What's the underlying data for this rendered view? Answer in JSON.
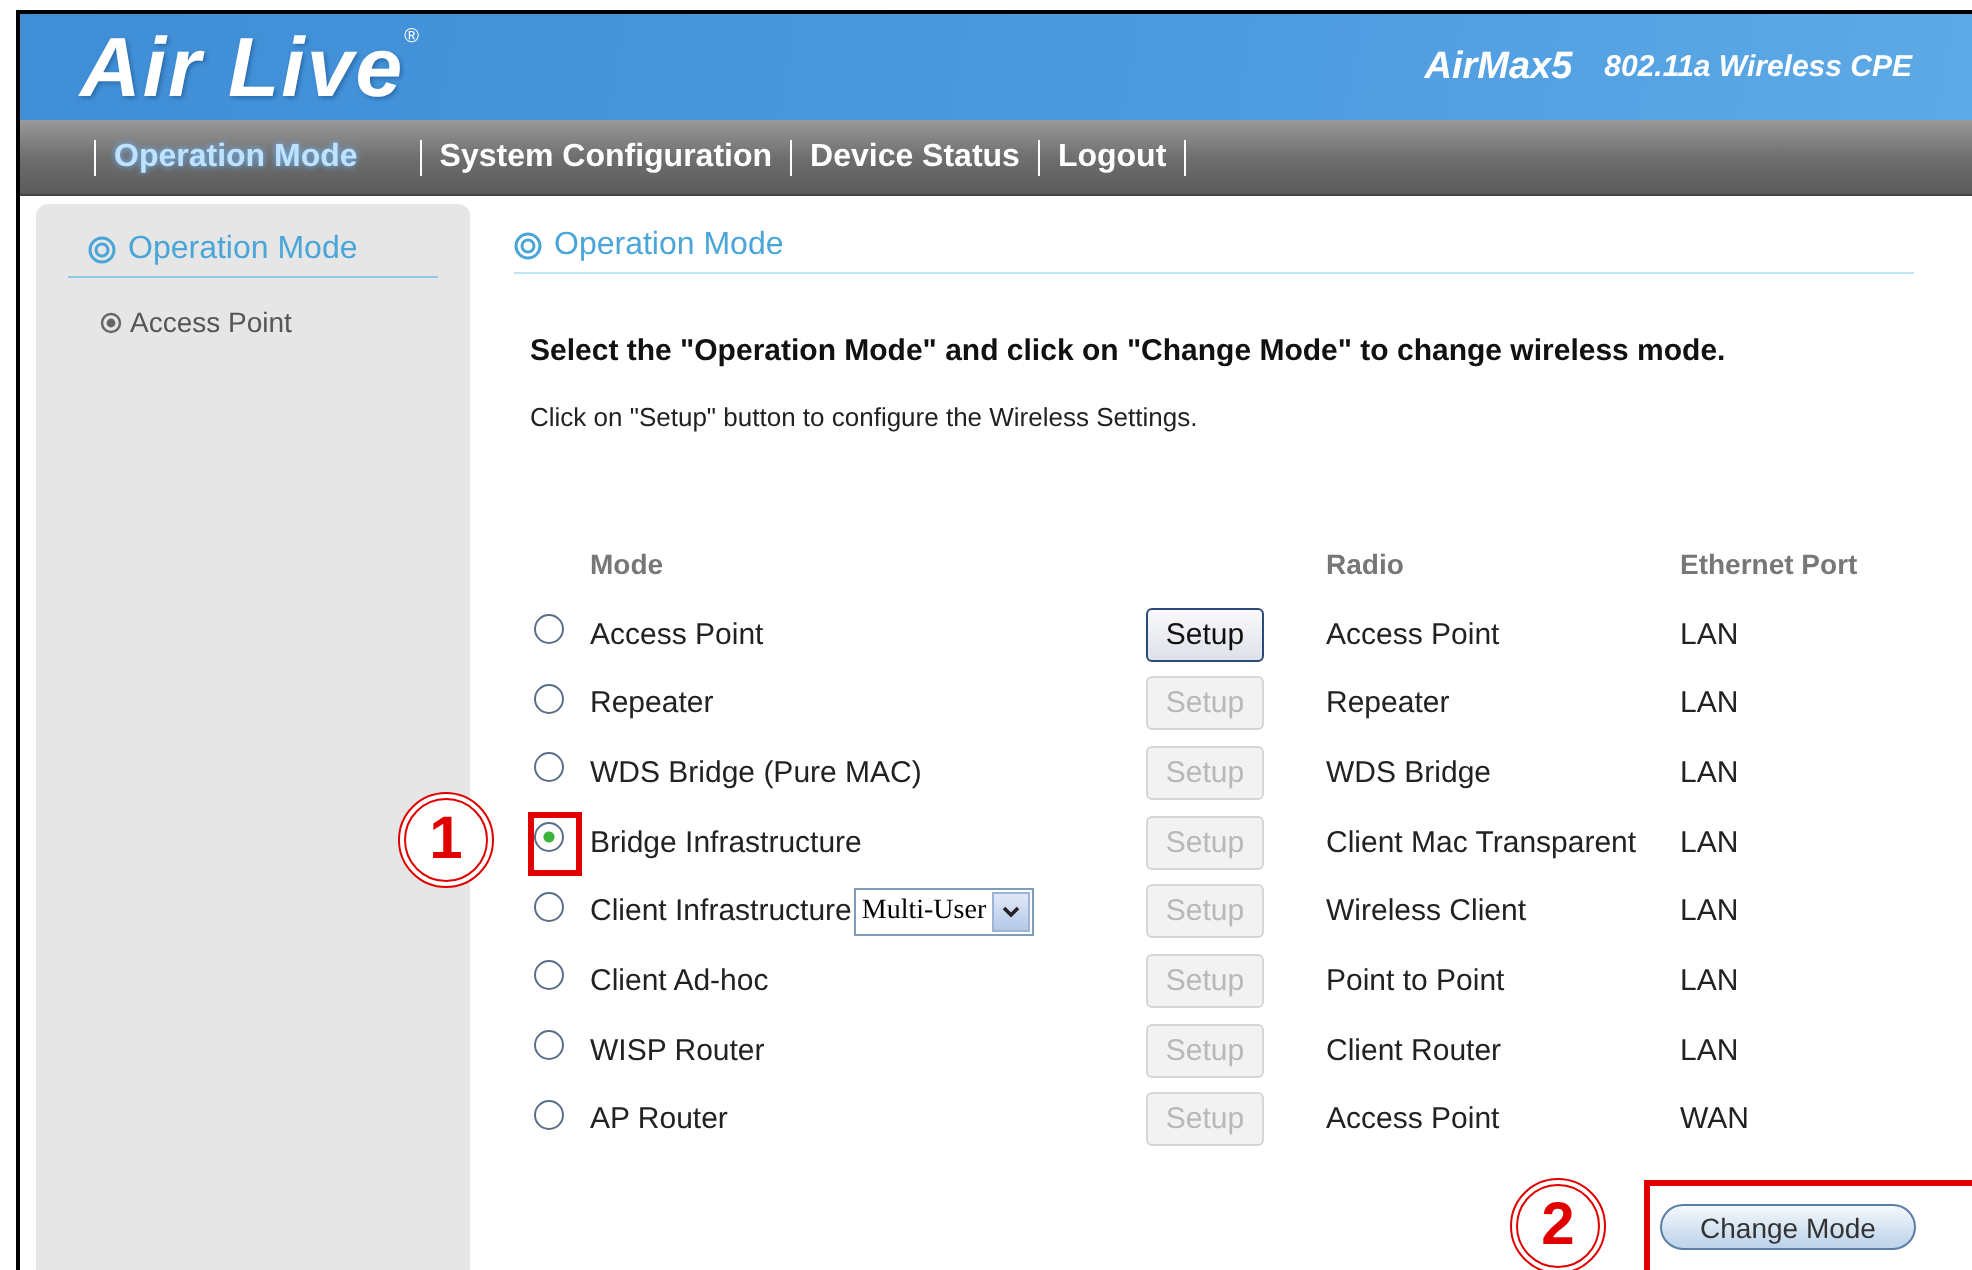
{
  "header": {
    "logo": "Air Live",
    "logo_mark": "®",
    "product": "AirMax5",
    "subtitle": "802.11a Wireless CPE"
  },
  "nav": [
    {
      "label": "Operation Mode",
      "selected": true
    },
    {
      "label": "System Configuration",
      "selected": false
    },
    {
      "label": "Device Status",
      "selected": false
    },
    {
      "label": "Logout",
      "selected": false
    }
  ],
  "sidebar": {
    "title": "Operation Mode",
    "items": [
      {
        "label": "Access Point",
        "selected": true
      }
    ]
  },
  "content": {
    "title": "Operation Mode",
    "instruction": "Select the \"Operation Mode\" and click on \"Change Mode\" to change wireless mode.",
    "note": "Click on \"Setup\" button to configure the Wireless Settings.",
    "columns": [
      "Mode",
      "Radio",
      "Ethernet Port"
    ],
    "rows": [
      {
        "mode": "Access Point",
        "selected": false,
        "setup": {
          "label": "Setup",
          "disabled": false
        },
        "radio": "Access Point",
        "port": "LAN"
      },
      {
        "mode": "Repeater",
        "selected": false,
        "setup": {
          "label": "Setup",
          "disabled": true
        },
        "radio": "Repeater",
        "port": "LAN"
      },
      {
        "mode": "WDS Bridge (Pure MAC)",
        "selected": false,
        "setup": {
          "label": "Setup",
          "disabled": true
        },
        "radio": "WDS Bridge",
        "port": "LAN"
      },
      {
        "mode": "Bridge Infrastructure",
        "selected": true,
        "setup": {
          "label": "Setup",
          "disabled": true
        },
        "radio": "Client Mac Transparent",
        "port": "LAN"
      },
      {
        "mode": "Client Infrastructure",
        "selected": false,
        "dropdown": {
          "value": "Multi-User"
        },
        "setup": {
          "label": "Setup",
          "disabled": true
        },
        "radio": "Wireless Client",
        "port": "LAN"
      },
      {
        "mode": "Client Ad-hoc",
        "selected": false,
        "setup": {
          "label": "Setup",
          "disabled": true
        },
        "radio": "Point to Point",
        "port": "LAN"
      },
      {
        "mode": "WISP Router",
        "selected": false,
        "setup": {
          "label": "Setup",
          "disabled": true
        },
        "radio": "Client Router",
        "port": "LAN"
      },
      {
        "mode": "AP Router",
        "selected": false,
        "setup": {
          "label": "Setup",
          "disabled": true
        },
        "radio": "Access Point",
        "port": "WAN"
      }
    ],
    "change_button": "Change Mode"
  },
  "annotations": [
    {
      "label": "1"
    },
    {
      "label": "2"
    }
  ]
}
